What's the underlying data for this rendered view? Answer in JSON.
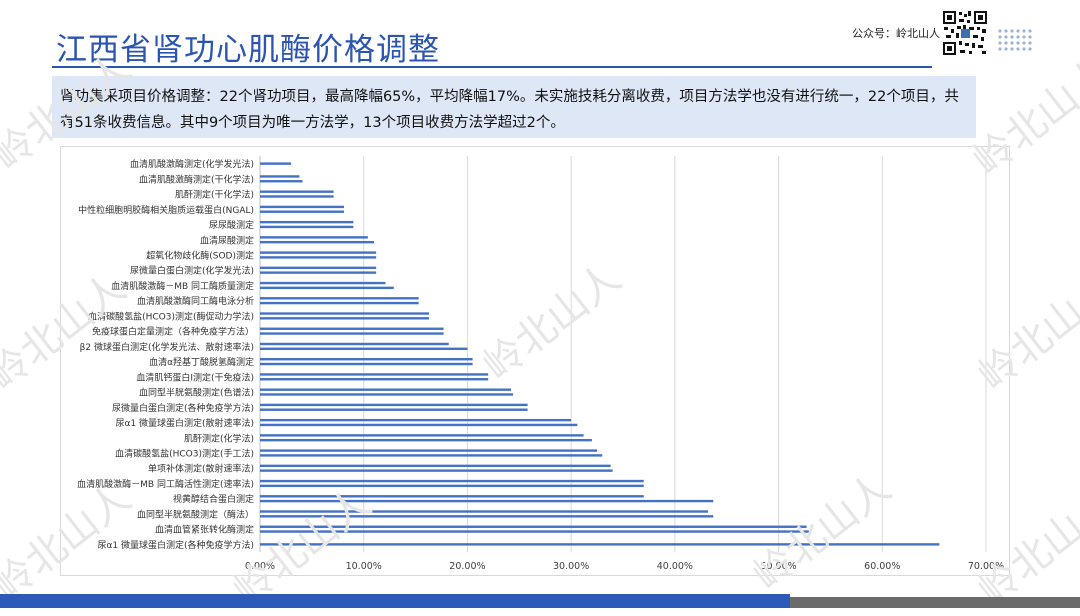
{
  "page": {
    "title": "江西省肾功心肌酶价格调整",
    "account_label": "公众号：岭北山人",
    "description": "肾功集采项目价格调整：22个肾功项目，最高降幅65%，平均降幅17%。未实施技耗分离收费，项目方法学也没有进行统一，22个项目，共有51条收费信息。其中9个项目为唯一方法学，13个项目收费方法学超过2个。",
    "watermark": "岭北山人"
  },
  "colors": {
    "title": "#2b55b0",
    "bar": "#4472c4",
    "panel": "#dde7f5",
    "footer": "#2d5ab8"
  },
  "chart_data": {
    "type": "bar",
    "orientation": "horizontal",
    "xlim": [
      0,
      0.7
    ],
    "x_ticks": [
      "0.00%",
      "10.00%",
      "20.00%",
      "30.00%",
      "40.00%",
      "50.00%",
      "60.00%",
      "70.00%"
    ],
    "grid": true,
    "categories": [
      "血清肌酸激酶测定(化学发光法)",
      "血清肌酸激酶测定(干化学法)",
      "肌酐测定(干化学法)",
      "中性粒细胞明胶酶相关脂质运载蛋白(NGAL)",
      "尿尿酸测定",
      "血清尿酸测定",
      "超氧化物歧化酶(SOD)测定",
      "尿微量白蛋白测定(化学发光法)",
      "血清肌酸激酶－MB 同工酶质量测定",
      "血清肌酸激酶同工酶电泳分析",
      "血清碳酸氢盐(HCO3)测定(酶促动力学法)",
      "免疫球蛋白定量测定（各种免疫学方法）",
      "β2 微球蛋白测定(化学发光法、散射速率法)",
      "血清α羟基丁酸脱氢酶测定",
      "血清肌钙蛋白Ⅰ测定(干免疫法)",
      "血同型半胱氨酸测定(色谱法)",
      "尿微量白蛋白测定(各种免疫学方法)",
      "尿α1 微量球蛋白测定(散射速率法)",
      "肌酐测定(化学法)",
      "血清碳酸氢盐(HCO3)测定(手工法)",
      "单项补体测定(散射速率法)",
      "血清肌酸激酶－MB 同工酶活性测定(速率法)",
      "视黄醇结合蛋白测定",
      "血同型半胱氨酸测定（酶法）",
      "血清血管紧张转化酶测定",
      "尿α1 微量球蛋白测定(各种免疫学方法)"
    ],
    "bar_rows": [
      [
        0.03
      ],
      [
        0.038,
        0.041
      ],
      [
        0.071,
        0.071
      ],
      [
        0.081,
        0.081
      ],
      [
        0.09,
        0.09
      ],
      [
        0.104,
        0.11
      ],
      [
        0.112,
        0.112
      ],
      [
        0.112,
        0.112
      ],
      [
        0.121,
        0.129
      ],
      [
        0.153,
        0.153
      ],
      [
        0.163,
        0.163
      ],
      [
        0.177,
        0.177
      ],
      [
        0.182,
        0.2
      ],
      [
        0.205,
        0.205
      ],
      [
        0.22,
        0.22
      ],
      [
        0.242,
        0.244
      ],
      [
        0.258,
        0.258
      ],
      [
        0.3,
        0.306
      ],
      [
        0.312,
        0.32
      ],
      [
        0.325,
        0.33
      ],
      [
        0.338,
        0.34
      ],
      [
        0.37,
        0.37
      ],
      [
        0.37,
        0.437
      ],
      [
        0.432,
        0.437
      ],
      [
        0.527,
        0.53
      ],
      [
        0.655
      ]
    ]
  }
}
